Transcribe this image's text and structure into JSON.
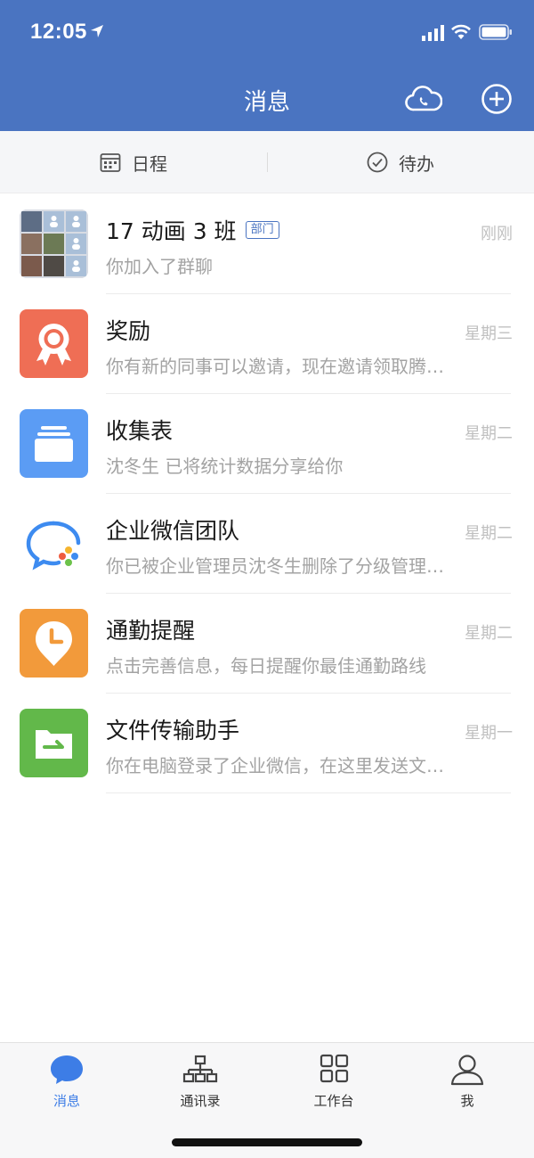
{
  "status": {
    "time": "12:05"
  },
  "header": {
    "title": "消息"
  },
  "quickbar": {
    "schedule_label": "日程",
    "todo_label": "待办"
  },
  "chats": [
    {
      "name": "17 动画 3 班",
      "badge": "部门",
      "preview": "你加入了群聊",
      "time": "刚刚",
      "avatar": "group-photo-avatar"
    },
    {
      "name": "奖励",
      "preview": "你有新的同事可以邀请，现在邀请领取腾…",
      "time": "星期三",
      "avatar": "award-icon",
      "color": "#ef6e55"
    },
    {
      "name": "收集表",
      "preview": "沈冬生 已将统计数据分享给你",
      "time": "星期二",
      "avatar": "collection-box-icon",
      "color": "#5b9cf4"
    },
    {
      "name": "企业微信团队",
      "preview": "你已被企业管理员沈冬生删除了分级管理…",
      "time": "星期二",
      "avatar": "wecom-logo-icon"
    },
    {
      "name": "通勤提醒",
      "preview": "点击完善信息，每日提醒你最佳通勤路线",
      "time": "星期二",
      "avatar": "clock-pin-icon",
      "color": "#f29a3b"
    },
    {
      "name": "文件传输助手",
      "preview": "你在电脑登录了企业微信，在这里发送文…",
      "time": "星期一",
      "avatar": "file-transfer-icon",
      "color": "#62b84a"
    }
  ],
  "tabs": [
    {
      "label": "消息",
      "icon": "chat-bubble-icon",
      "active": true
    },
    {
      "label": "通讯录",
      "icon": "org-chart-icon"
    },
    {
      "label": "工作台",
      "icon": "grid-icon"
    },
    {
      "label": "我",
      "icon": "person-icon"
    }
  ],
  "colors": {
    "brand": "#4a74c1",
    "active_tab": "#3d7de6"
  }
}
